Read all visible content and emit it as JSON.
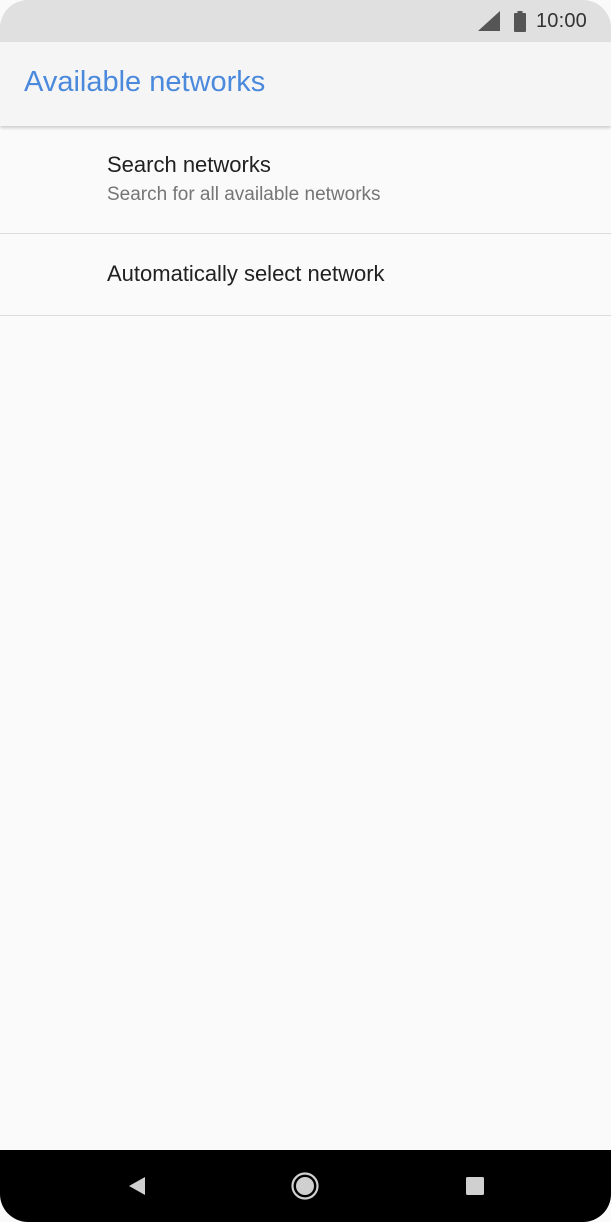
{
  "status_bar": {
    "time": "10:00",
    "icons": [
      "cell-signal-icon",
      "battery-icon"
    ]
  },
  "app_bar": {
    "title": "Available networks",
    "title_color": "#4a89dc"
  },
  "list": {
    "items": [
      {
        "title": "Search networks",
        "subtitle": "Search for all available networks"
      },
      {
        "title": "Automatically select network"
      }
    ]
  },
  "nav_bar": {
    "buttons": [
      "back-icon",
      "home-icon",
      "recents-icon"
    ]
  }
}
